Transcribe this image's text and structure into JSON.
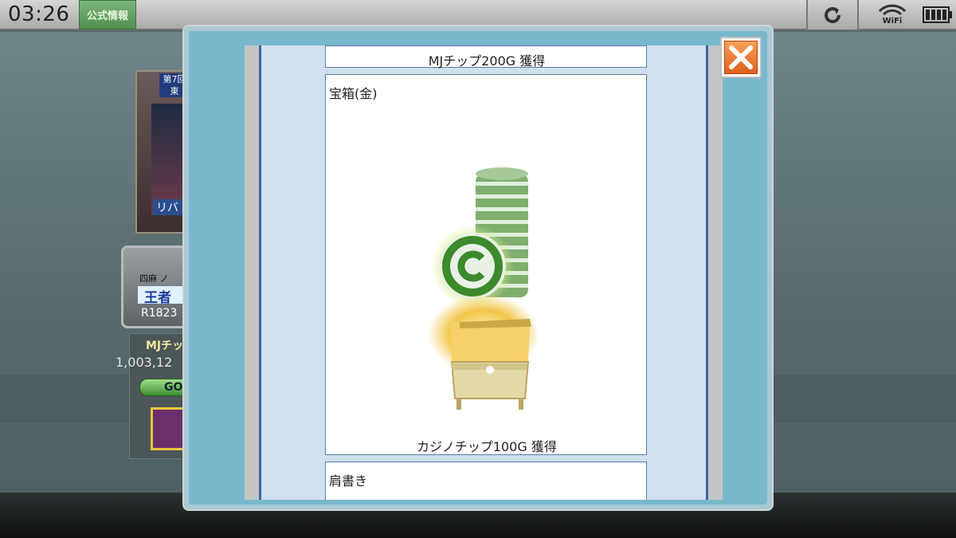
{
  "status_bar": {
    "time": "03:26",
    "official_info_label": "公式情報",
    "reload_icon": "reload-icon",
    "wifi_label": "WiFi",
    "battery_icon": "battery-icon"
  },
  "background": {
    "portrait_tag": "第7回 東",
    "portrait_name": "リバ",
    "rank_card": {
      "line1": "ノ",
      "mode": "四麻",
      "title": "王者",
      "rating": "R1823"
    },
    "chips_title": "MJチッ",
    "chips_value": "1,003,12",
    "go_label": "GO"
  },
  "modal": {
    "items": [
      {
        "caption": "MJチップ200G 獲得"
      },
      {
        "title": "宝箱(金)",
        "caption": "カジノチップ100G 獲得"
      },
      {
        "title": "肩書き"
      }
    ],
    "close_icon": "close-icon"
  },
  "colors": {
    "modal_frame": "#78b8cc",
    "content_bg": "#cfe0ee",
    "close_button": "#ee7a33",
    "chip_green": "#3c8a2c"
  }
}
